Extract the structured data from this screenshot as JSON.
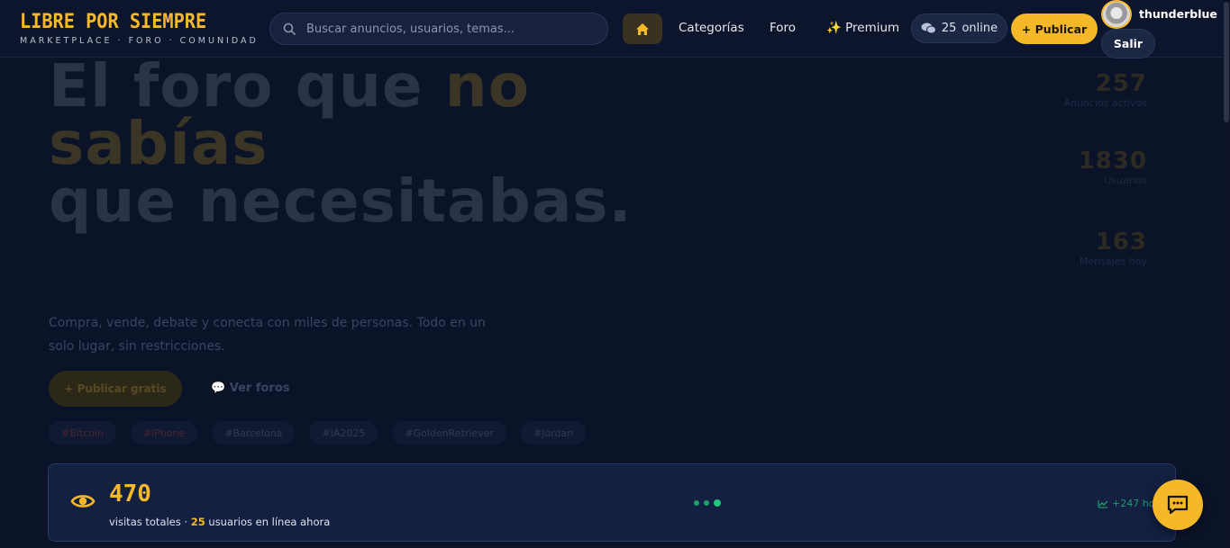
{
  "brand": {
    "title": "LIBRE POR SIEMPRE",
    "subtitle": "MARKETPLACE · FORO · COMUNIDAD"
  },
  "search": {
    "placeholder": "Buscar anuncios, usuarios, temas..."
  },
  "nav": {
    "categories": "Categorías",
    "forum": "Foro",
    "premium": "✨ Premium",
    "online_count": "25",
    "online_label": "online",
    "publish": "+ Publicar"
  },
  "user": {
    "name": "thunderblue",
    "logout": "Salir"
  },
  "hero": {
    "title_part1": "El foro que ",
    "title_accent": "no sabías",
    "title_part2": "que necesitabas.",
    "subtitle": "Compra, vende, debate y conecta con miles de personas. Todo en un solo lugar, sin restricciones.",
    "primary_button": "+ Publicar gratis",
    "secondary_button": "Ver foros",
    "tags": [
      "#Bitcoin",
      "#iPhone",
      "#Barcelona",
      "#IA2025",
      "#GoldenRetriever",
      "#Jordan"
    ]
  },
  "stats": [
    {
      "value": "257",
      "label": "Anuncios activos"
    },
    {
      "value": "1830",
      "label": "Usuarios"
    },
    {
      "value": "163",
      "label": "Mensajes hoy"
    }
  ],
  "visits": {
    "count": "470",
    "label_before": "visitas totales · ",
    "users_online": "25",
    "label_after": " usuarios en línea ahora",
    "trend": "+247 hoy"
  },
  "colors": {
    "accent": "#f5b829",
    "background": "#0b1329",
    "success": "#22c67f"
  }
}
